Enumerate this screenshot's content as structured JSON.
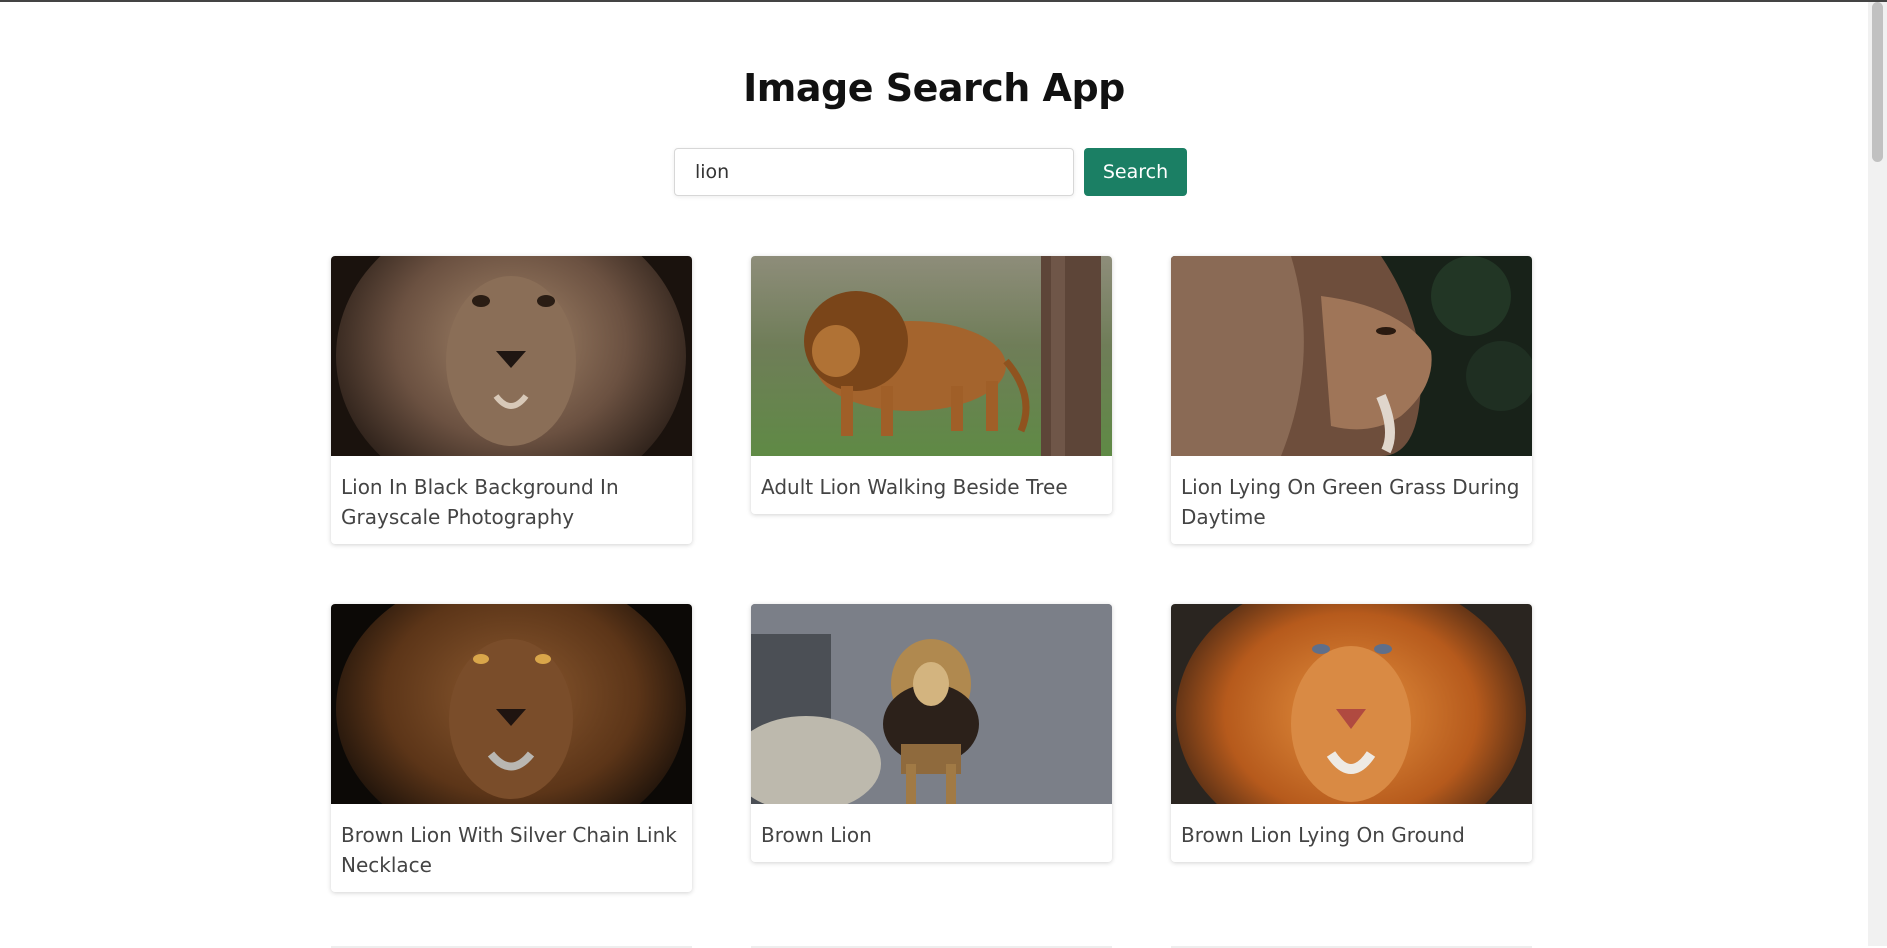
{
  "app": {
    "title": "Image Search App"
  },
  "search": {
    "value": "lion",
    "button_label": "Search"
  },
  "results": [
    {
      "caption": "Lion In Black Background In Grayscale Photography",
      "image_theme": "sepia"
    },
    {
      "caption": "Adult Lion Walking Beside Tree",
      "image_theme": "grass"
    },
    {
      "caption": "Lion Lying On Green Grass During Daytime",
      "image_theme": "dark-green"
    },
    {
      "caption": "Brown Lion With Silver Chain Link Necklace",
      "image_theme": "dark-brown"
    },
    {
      "caption": "Brown Lion",
      "image_theme": "rock-gray"
    },
    {
      "caption": "Brown Lion Lying On Ground",
      "image_theme": "orange"
    }
  ],
  "colors": {
    "accent": "#1b7f64"
  }
}
